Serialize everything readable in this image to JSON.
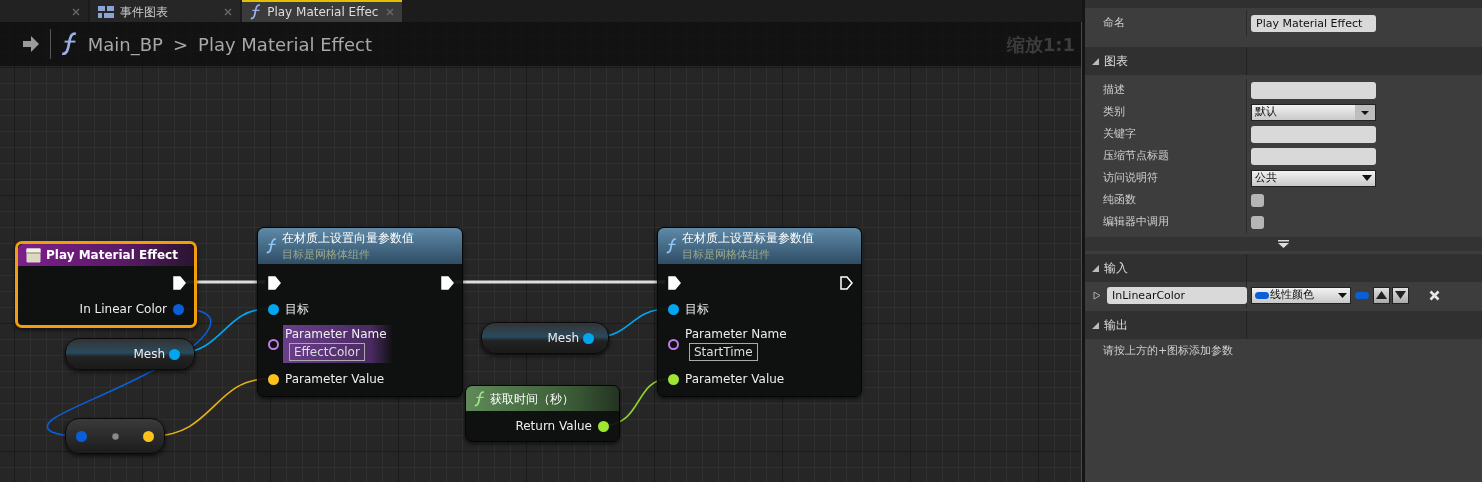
{
  "tabs": [
    {
      "kind": "blank",
      "selected": false
    },
    {
      "kind": "graph",
      "label": "事件图表",
      "selected": false
    },
    {
      "kind": "function",
      "label": "Play Material Effec",
      "selected": true
    }
  ],
  "breadcrumb": {
    "path": [
      "Main_BP",
      "Play Material Effect"
    ],
    "separator": ">",
    "zoom_label": "缩放1:1"
  },
  "nodes": [
    {
      "kind": "event",
      "title": "Play Material Effect",
      "selected": true,
      "outputs": [
        {
          "kind": "exec",
          "connected": true
        },
        {
          "kind": "color",
          "label": "In Linear Color",
          "connected": true
        }
      ]
    },
    {
      "kind": "variable",
      "selected": false,
      "outputs": [
        {
          "kind": "object",
          "label": "Mesh",
          "connected": true
        }
      ]
    },
    {
      "kind": "make",
      "selected": false,
      "inputs": [
        {
          "kind": "color",
          "connected": true
        }
      ],
      "outputs": [
        {
          "kind": "vector",
          "connected": true
        }
      ]
    },
    {
      "kind": "function",
      "title": "在材质上设置向量参数值",
      "subtitle": "目标是网格体组件",
      "selected": false,
      "inputs": [
        {
          "kind": "exec",
          "connected": true
        },
        {
          "kind": "object",
          "label": "目标",
          "connected": true
        },
        {
          "kind": "name",
          "label": "Parameter Name",
          "connected": false,
          "value": "EffectColor",
          "highlighted": true
        },
        {
          "kind": "vector",
          "label": "Parameter Value",
          "connected": true
        }
      ],
      "outputs": [
        {
          "kind": "exec",
          "connected": true
        }
      ]
    },
    {
      "kind": "variable",
      "selected": false,
      "outputs": [
        {
          "kind": "object",
          "label": "Mesh",
          "connected": true
        }
      ]
    },
    {
      "kind": "pure",
      "title": "获取时间（秒）",
      "selected": false,
      "outputs": [
        {
          "kind": "float",
          "label": "Return Value",
          "connected": true
        }
      ]
    },
    {
      "kind": "function",
      "title": "在材质上设置标量参数值",
      "subtitle": "目标是网格体组件",
      "selected": false,
      "inputs": [
        {
          "kind": "exec",
          "connected": true
        },
        {
          "kind": "object",
          "label": "目标",
          "connected": true
        },
        {
          "kind": "name",
          "label": "Parameter Name",
          "connected": false,
          "value": "StartTime",
          "highlighted": false
        },
        {
          "kind": "float",
          "label": "Parameter Value",
          "connected": true
        }
      ],
      "outputs": [
        {
          "kind": "exec",
          "connected": false
        }
      ]
    }
  ],
  "details": {
    "name_row": {
      "label": "命名",
      "value": "Play Material Effect"
    },
    "sections": [
      {
        "kind": "properties",
        "title": "图表",
        "expanded": true,
        "rows": [
          {
            "label": "描述",
            "kind": "text"
          },
          {
            "label": "类别",
            "kind": "combo",
            "value": "默认"
          },
          {
            "label": "关键字",
            "kind": "text"
          },
          {
            "label": "压缩节点标题",
            "kind": "text"
          },
          {
            "label": "访问说明符",
            "kind": "dropdown",
            "value": "公共"
          },
          {
            "label": "纯函数",
            "kind": "checkbox",
            "checked": false
          },
          {
            "label": "编辑器中调用",
            "kind": "checkbox",
            "checked": false
          }
        ]
      },
      {
        "kind": "inputs",
        "title": "输入",
        "expanded": true,
        "params": [
          {
            "name": "InLinearColor",
            "type": "线性颜色",
            "expanded": false
          }
        ]
      },
      {
        "kind": "outputs",
        "title": "输出",
        "expanded": true,
        "hint": "请按上方的+图标添加参数"
      }
    ]
  }
}
